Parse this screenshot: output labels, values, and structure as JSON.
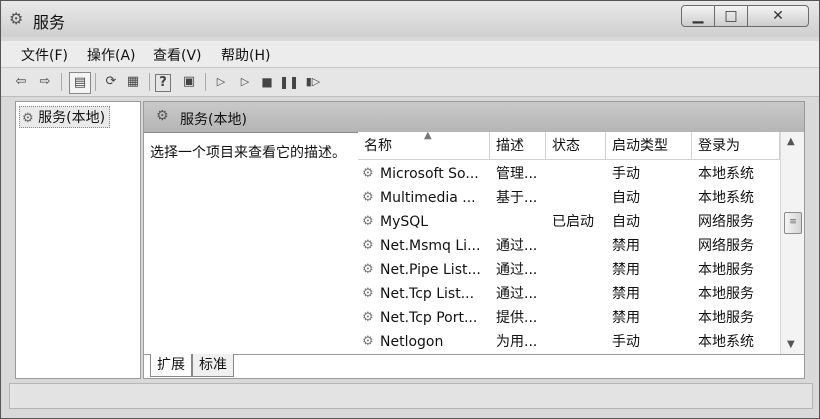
{
  "window": {
    "title": "服务"
  },
  "menu": [
    "文件(F)",
    "操作(A)",
    "查看(V)",
    "帮助(H)"
  ],
  "toolbar": {
    "buttons": [
      "back-icon",
      "forward-icon",
      "console-tree-icon",
      "refresh-icon",
      "export-list-icon",
      "help-icon",
      "properties-icon",
      "start-icon",
      "start-alt-icon",
      "stop-icon",
      "pause-icon",
      "restart-icon"
    ]
  },
  "tree": {
    "root": "服务(本地)"
  },
  "main": {
    "header": "服务(本地)",
    "description": "选择一个项目来查看它的描述。"
  },
  "table": {
    "columns": [
      "名称",
      "描述",
      "状态",
      "启动类型",
      "登录为"
    ],
    "rows": [
      {
        "name": "Microsoft So...",
        "desc": "管理...",
        "status": "",
        "startup": "手动",
        "logon": "本地系统"
      },
      {
        "name": "Multimedia ...",
        "desc": "基于...",
        "status": "",
        "startup": "自动",
        "logon": "本地系统"
      },
      {
        "name": "MySQL",
        "desc": "",
        "status": "已启动",
        "startup": "自动",
        "logon": "网络服务"
      },
      {
        "name": "Net.Msmq Li...",
        "desc": "通过...",
        "status": "",
        "startup": "禁用",
        "logon": "网络服务"
      },
      {
        "name": "Net.Pipe List...",
        "desc": "通过...",
        "status": "",
        "startup": "禁用",
        "logon": "本地服务"
      },
      {
        "name": "Net.Tcp List...",
        "desc": "通过...",
        "status": "",
        "startup": "禁用",
        "logon": "本地服务"
      },
      {
        "name": "Net.Tcp Port...",
        "desc": "提供...",
        "status": "",
        "startup": "禁用",
        "logon": "本地服务"
      },
      {
        "name": "Netlogon",
        "desc": "为用...",
        "status": "",
        "startup": "手动",
        "logon": "本地系统"
      }
    ]
  },
  "tabs": [
    "扩展",
    "标准"
  ]
}
